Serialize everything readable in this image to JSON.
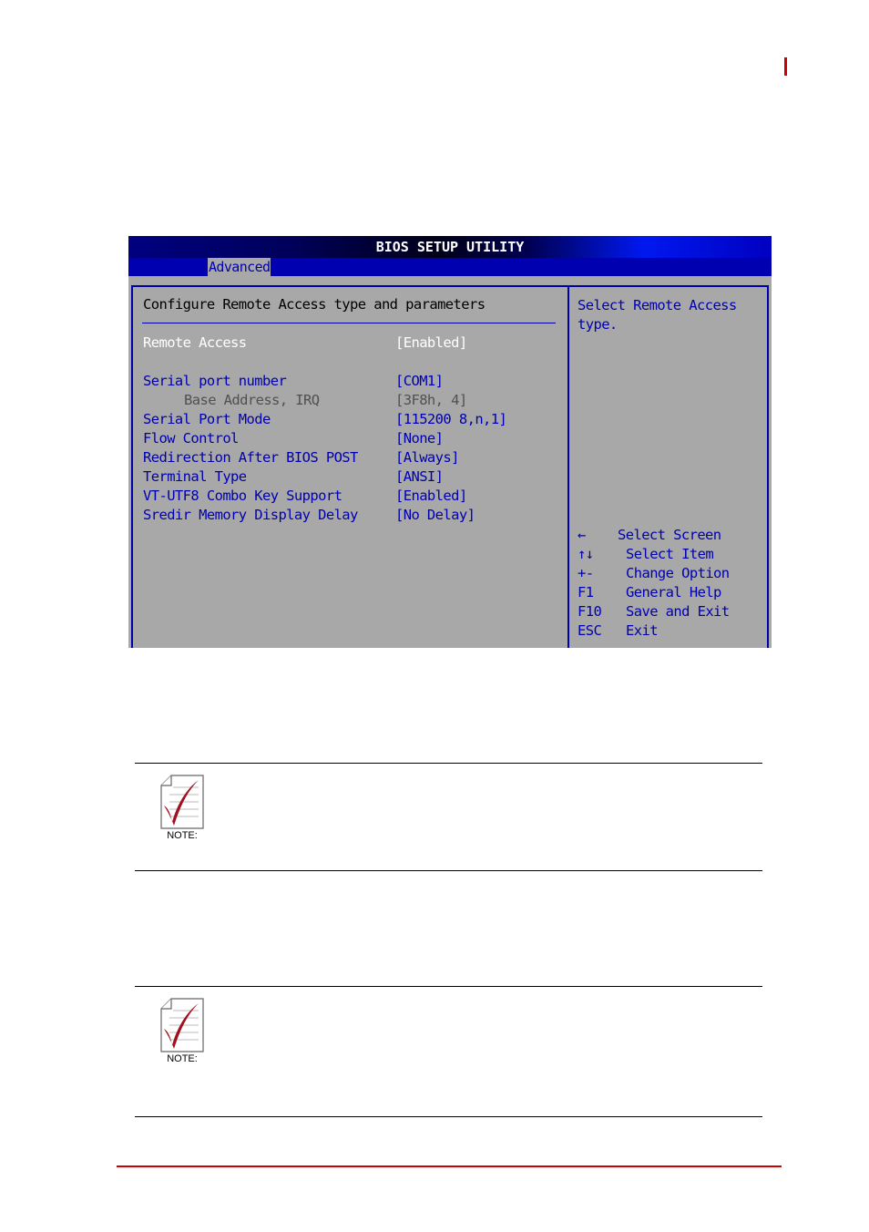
{
  "bios": {
    "title": "BIOS SETUP UTILITY",
    "active_tab": "Advanced",
    "heading": "Configure Remote Access type and parameters",
    "settings": [
      {
        "label": "Remote Access",
        "value": "[Enabled]",
        "state": "active"
      },
      {
        "label": "Serial port number",
        "value": "[COM1]",
        "state": "normal"
      },
      {
        "label": "Base Address, IRQ",
        "value": "[3F8h, 4]",
        "state": "disabled"
      },
      {
        "label": "Serial Port Mode",
        "value": "[115200 8,n,1]",
        "state": "normal"
      },
      {
        "label": "Flow Control",
        "value": "[None]",
        "state": "normal"
      },
      {
        "label": "Redirection After BIOS POST",
        "value": "[Always]",
        "state": "normal"
      },
      {
        "label": "Terminal Type",
        "value": "[ANSI]",
        "state": "normal"
      },
      {
        "label": "VT-UTF8 Combo Key Support",
        "value": "[Enabled]",
        "state": "normal"
      },
      {
        "label": "Sredir Memory Display Delay",
        "value": "[No Delay]",
        "state": "normal"
      }
    ],
    "help_text": "Select Remote Access type.",
    "key_legend": [
      {
        "key": "←",
        "desc": "Select Screen"
      },
      {
        "key": "↑↓",
        "desc": "Select Item"
      },
      {
        "key": "+-",
        "desc": "Change Option"
      },
      {
        "key": "F1",
        "desc": "General Help"
      },
      {
        "key": "F10",
        "desc": "Save and Exit"
      },
      {
        "key": "ESC",
        "desc": "Exit"
      }
    ]
  },
  "notes": [
    {
      "label": "NOTE:",
      "icon": "note-checkmark-icon"
    },
    {
      "label": "NOTE:",
      "icon": "note-checkmark-icon"
    }
  ],
  "colors": {
    "accent_red": "#cc0000",
    "bios_blue": "#0000b0",
    "bios_gray": "#a8a8a8"
  }
}
